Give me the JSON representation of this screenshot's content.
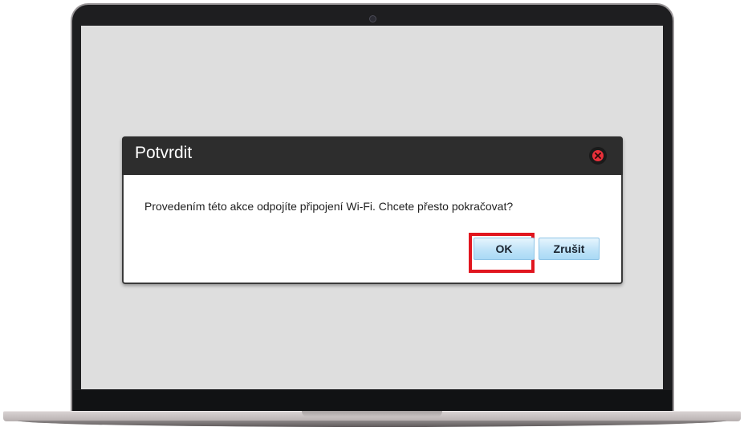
{
  "dialog": {
    "title": "Potvrdit",
    "message": "Provedením této akce odpojíte připojení Wi-Fi. Chcete přesto pokračovat?",
    "ok_label": "OK",
    "cancel_label": "Zrušit",
    "close_icon": "close-icon"
  },
  "colors": {
    "header_bg": "#2d2d2d",
    "close_red": "#e8303a",
    "highlight_red": "#e1161f",
    "button_blue": "#bfe3f8",
    "screen_bg": "#dedede"
  }
}
